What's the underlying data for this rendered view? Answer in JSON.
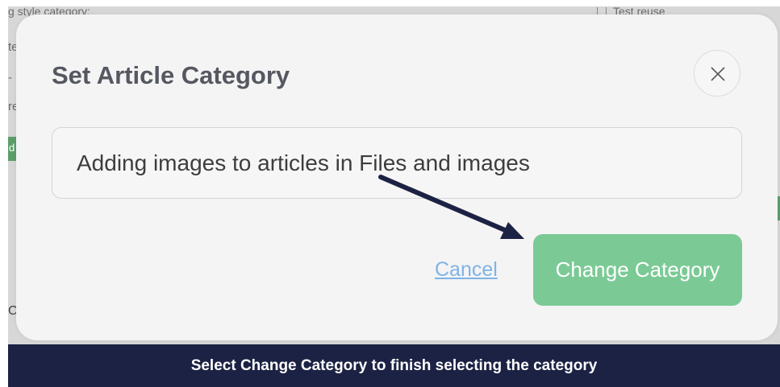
{
  "background": {
    "fragments": [
      "g style category:",
      "te",
      "-",
      "re",
      "d",
      "C"
    ],
    "right_item": "Test reuse"
  },
  "modal": {
    "title": "Set Article Category",
    "input_value": "Adding images to articles in Files and images",
    "cancel_label": "Cancel",
    "confirm_label": "Change Category",
    "close_icon": "close-icon"
  },
  "caption": {
    "text": "Select Change Category to finish selecting the category"
  },
  "colors": {
    "accent_green": "#7bca95",
    "link_blue": "#7fb3e6",
    "caption_bg": "#1c2244",
    "arrow": "#1c2244"
  }
}
